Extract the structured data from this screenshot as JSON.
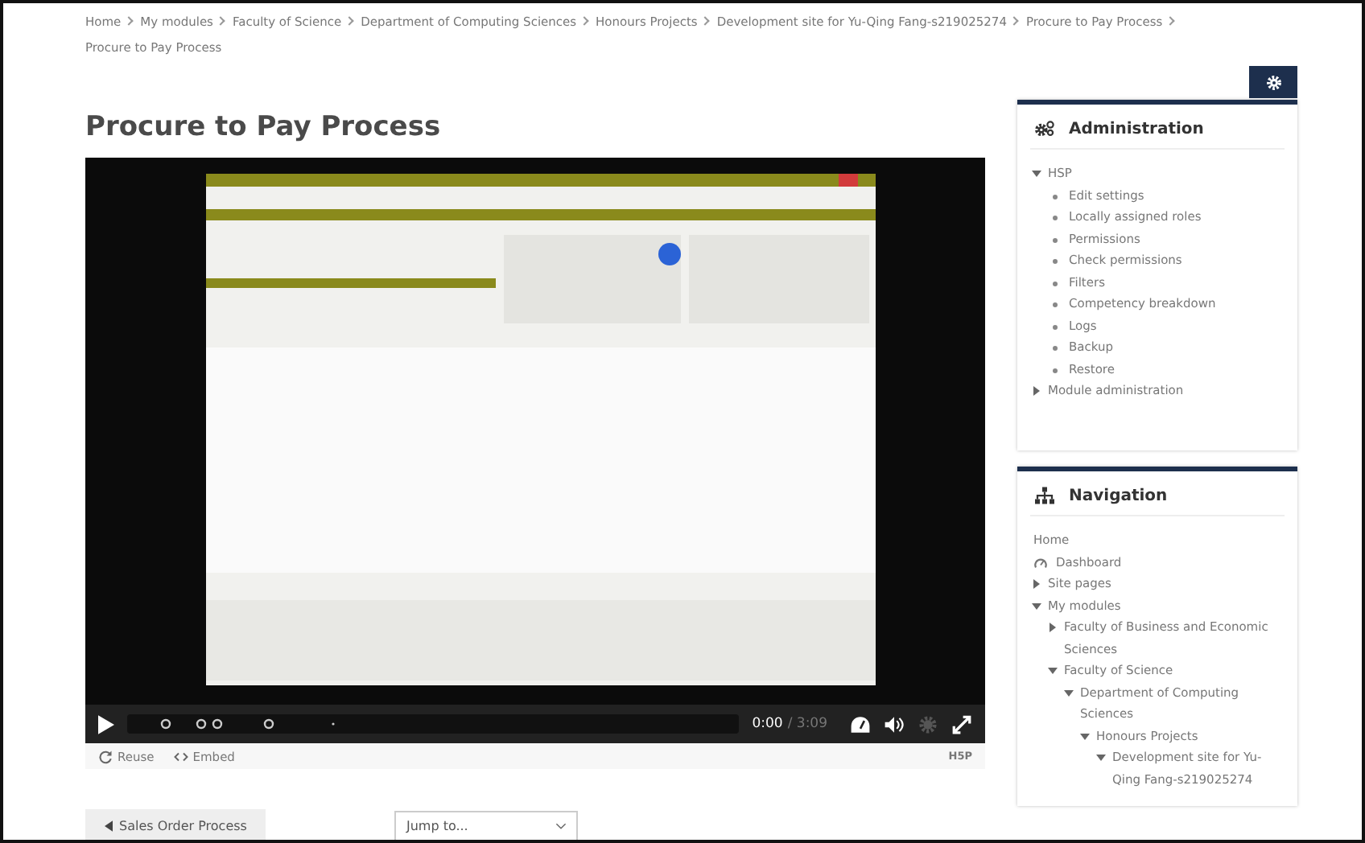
{
  "breadcrumb": [
    "Home",
    "My modules",
    "Faculty of Science",
    "Department of Computing Sciences",
    "Honours Projects",
    "Development site for Yu-Qing Fang-s219025274",
    "Procure to Pay Process",
    "Procure to Pay Process"
  ],
  "page_title": "Procure to Pay Process",
  "video": {
    "time_current": "0:00",
    "time_total": "/ 3:09",
    "footer_links": [
      {
        "label": "Reuse",
        "kind": "reuse"
      },
      {
        "label": "Embed",
        "kind": "embed"
      }
    ],
    "logo": "H5P"
  },
  "bottom_nav": {
    "previous": "Sales Order Process",
    "jump_placeholder": "Jump to..."
  },
  "administration": {
    "title": "Administration",
    "items": [
      {
        "label": "HSP",
        "kind": "branch",
        "expanded": true,
        "children": [
          {
            "label": "Edit settings",
            "kind": "leaf"
          },
          {
            "label": "Locally assigned roles",
            "kind": "leaf"
          },
          {
            "label": "Permissions",
            "kind": "leaf"
          },
          {
            "label": "Check permissions",
            "kind": "leaf"
          },
          {
            "label": "Filters",
            "kind": "leaf"
          },
          {
            "label": "Competency breakdown",
            "kind": "leaf"
          },
          {
            "label": "Logs",
            "kind": "leaf"
          },
          {
            "label": "Backup",
            "kind": "leaf"
          },
          {
            "label": "Restore",
            "kind": "leaf"
          }
        ]
      },
      {
        "label": "Module administration",
        "kind": "branch",
        "expanded": false
      }
    ]
  },
  "navigation": {
    "title": "Navigation",
    "items": [
      {
        "label": "Home",
        "kind": "plain"
      },
      {
        "label": "Dashboard",
        "kind": "dashboard"
      },
      {
        "label": "Site pages",
        "kind": "branch",
        "expanded": false
      },
      {
        "label": "My modules",
        "kind": "branch",
        "expanded": true,
        "children": [
          {
            "label": "Faculty of Business and Economic Sciences",
            "kind": "branch",
            "expanded": false
          },
          {
            "label": "Faculty of Science",
            "kind": "branch",
            "expanded": true,
            "children": [
              {
                "label": "Department of Computing Sciences",
                "kind": "branch",
                "expanded": true,
                "children": [
                  {
                    "label": "Honours Projects",
                    "kind": "branch",
                    "expanded": true,
                    "children": [
                      {
                        "label": "Development site for Yu-Qing Fang-s219025274",
                        "kind": "branch",
                        "expanded": true
                      }
                    ]
                  }
                ]
              }
            ]
          }
        ]
      }
    ]
  }
}
